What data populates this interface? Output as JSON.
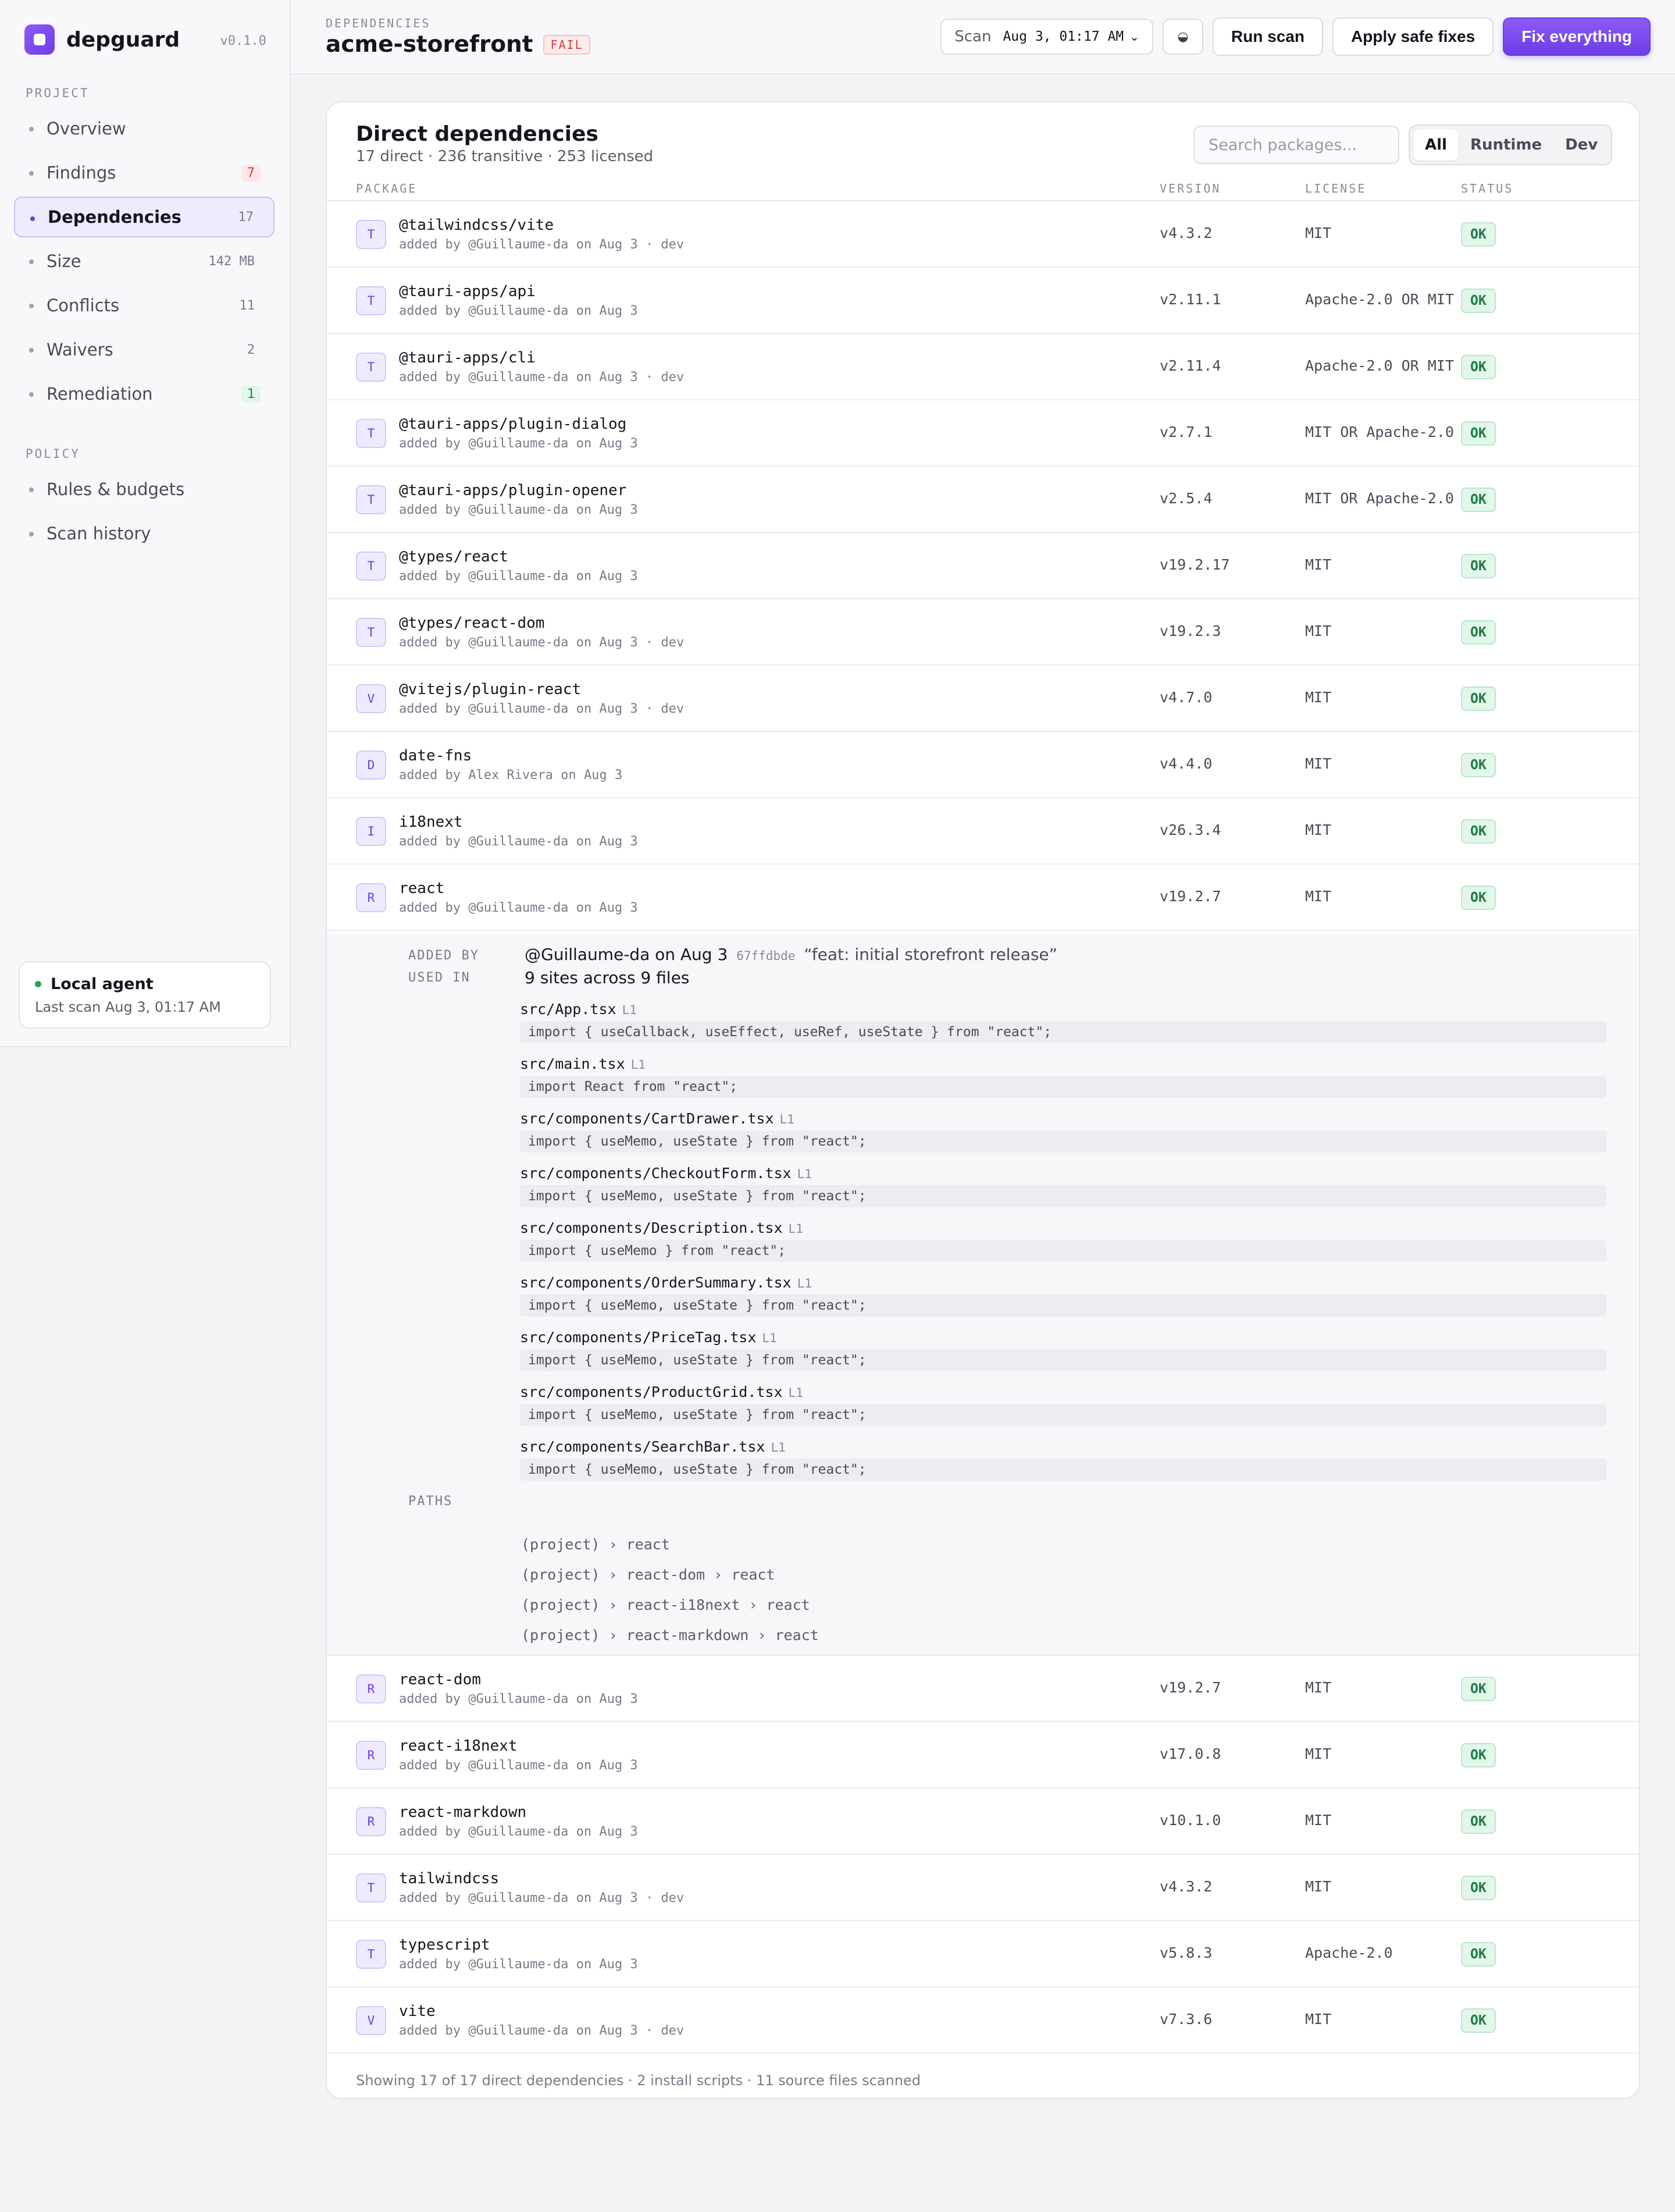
{
  "app": {
    "name": "depguard",
    "version": "v0.1.0"
  },
  "sidebar": {
    "project_label": "PROJECT",
    "policy_label": "POLICY",
    "project_items": [
      {
        "label": "Overview",
        "badge": ""
      },
      {
        "label": "Findings",
        "badge": "7"
      },
      {
        "label": "Dependencies",
        "badge": "17"
      },
      {
        "label": "Size",
        "badge": "142 MB"
      },
      {
        "label": "Conflicts",
        "badge": "11"
      },
      {
        "label": "Waivers",
        "badge": "2"
      },
      {
        "label": "Remediation",
        "badge": "1"
      }
    ],
    "policy_items": [
      {
        "label": "Rules & budgets"
      },
      {
        "label": "Scan history"
      }
    ],
    "agent": {
      "title": "Local agent",
      "subtitle": "Last scan Aug 3, 01:17 AM"
    }
  },
  "header": {
    "breadcrumb": "DEPENDENCIES",
    "project": "acme-storefront",
    "status": "FAIL",
    "scan_label": "Scan",
    "scan_value": "Aug 3, 01:17 AM",
    "theme_icon": "◒",
    "run_scan": "Run scan",
    "apply_safe": "Apply safe fixes",
    "fix_all": "Fix everything"
  },
  "card": {
    "title": "Direct dependencies",
    "subtitle": "17 direct · 236 transitive · 253 licensed",
    "search_placeholder": "Search packages...",
    "filters": [
      "All",
      "Runtime",
      "Dev"
    ],
    "columns": {
      "package": "PACKAGE",
      "version": "VERSION",
      "license": "LICENSE",
      "status": "STATUS"
    },
    "rows": [
      {
        "initial": "T",
        "name": "@tailwindcss/vite",
        "meta": "added by @Guillaume-da on Aug 3 · dev",
        "version": "v4.3.2",
        "license": "MIT",
        "status": "OK"
      },
      {
        "initial": "T",
        "name": "@tauri-apps/api",
        "meta": "added by @Guillaume-da on Aug 3",
        "version": "v2.11.1",
        "license": "Apache-2.0 OR MIT",
        "status": "OK"
      },
      {
        "initial": "T",
        "name": "@tauri-apps/cli",
        "meta": "added by @Guillaume-da on Aug 3 · dev",
        "version": "v2.11.4",
        "license": "Apache-2.0 OR MIT",
        "status": "OK"
      },
      {
        "initial": "T",
        "name": "@tauri-apps/plugin-dialog",
        "meta": "added by @Guillaume-da on Aug 3",
        "version": "v2.7.1",
        "license": "MIT OR Apache-2.0",
        "status": "OK"
      },
      {
        "initial": "T",
        "name": "@tauri-apps/plugin-opener",
        "meta": "added by @Guillaume-da on Aug 3",
        "version": "v2.5.4",
        "license": "MIT OR Apache-2.0",
        "status": "OK"
      },
      {
        "initial": "T",
        "name": "@types/react",
        "meta": "added by @Guillaume-da on Aug 3",
        "version": "v19.2.17",
        "license": "MIT",
        "status": "OK"
      },
      {
        "initial": "T",
        "name": "@types/react-dom",
        "meta": "added by @Guillaume-da on Aug 3 · dev",
        "version": "v19.2.3",
        "license": "MIT",
        "status": "OK"
      },
      {
        "initial": "V",
        "name": "@vitejs/plugin-react",
        "meta": "added by @Guillaume-da on Aug 3 · dev",
        "version": "v4.7.0",
        "license": "MIT",
        "status": "OK"
      },
      {
        "initial": "D",
        "name": "date-fns",
        "meta": "added by Alex Rivera on Aug 3",
        "version": "v4.4.0",
        "license": "MIT",
        "status": "OK"
      },
      {
        "initial": "I",
        "name": "i18next",
        "meta": "added by @Guillaume-da on Aug 3",
        "version": "v26.3.4",
        "license": "MIT",
        "status": "OK"
      },
      {
        "initial": "R",
        "name": "react",
        "meta": "added by @Guillaume-da on Aug 3",
        "version": "v19.2.7",
        "license": "MIT",
        "status": "OK"
      },
      {
        "initial": "R",
        "name": "react-dom",
        "meta": "added by @Guillaume-da on Aug 3",
        "version": "v19.2.7",
        "license": "MIT",
        "status": "OK"
      },
      {
        "initial": "R",
        "name": "react-i18next",
        "meta": "added by @Guillaume-da on Aug 3",
        "version": "v17.0.8",
        "license": "MIT",
        "status": "OK"
      },
      {
        "initial": "R",
        "name": "react-markdown",
        "meta": "added by @Guillaume-da on Aug 3",
        "version": "v10.1.0",
        "license": "MIT",
        "status": "OK"
      },
      {
        "initial": "T",
        "name": "tailwindcss",
        "meta": "added by @Guillaume-da on Aug 3 · dev",
        "version": "v4.3.2",
        "license": "MIT",
        "status": "OK"
      },
      {
        "initial": "T",
        "name": "typescript",
        "meta": "added by @Guillaume-da on Aug 3",
        "version": "v5.8.3",
        "license": "Apache-2.0",
        "status": "OK"
      },
      {
        "initial": "V",
        "name": "vite",
        "meta": "added by @Guillaume-da on Aug 3 · dev",
        "version": "v7.3.6",
        "license": "MIT",
        "status": "OK"
      }
    ],
    "detail": {
      "added_by_label": "ADDED BY",
      "used_in_label": "USED IN",
      "paths_label": "PATHS",
      "added_by": "@Guillaume-da on Aug 3",
      "commit": "67ffdbde",
      "commit_msg": "“feat: initial storefront release”",
      "used_in": "9 sites across 9 files",
      "sites": [
        {
          "file": "src/App.tsx",
          "line": "L1",
          "code": "import { useCallback, useEffect, useRef, useState } from \"react\";"
        },
        {
          "file": "src/main.tsx",
          "line": "L1",
          "code": "import React from \"react\";"
        },
        {
          "file": "src/components/CartDrawer.tsx",
          "line": "L1",
          "code": "import { useMemo, useState } from \"react\";"
        },
        {
          "file": "src/components/CheckoutForm.tsx",
          "line": "L1",
          "code": "import { useMemo, useState } from \"react\";"
        },
        {
          "file": "src/components/Description.tsx",
          "line": "L1",
          "code": "import { useMemo } from \"react\";"
        },
        {
          "file": "src/components/OrderSummary.tsx",
          "line": "L1",
          "code": "import { useMemo, useState } from \"react\";"
        },
        {
          "file": "src/components/PriceTag.tsx",
          "line": "L1",
          "code": "import { useMemo, useState } from \"react\";"
        },
        {
          "file": "src/components/ProductGrid.tsx",
          "line": "L1",
          "code": "import { useMemo, useState } from \"react\";"
        },
        {
          "file": "src/components/SearchBar.tsx",
          "line": "L1",
          "code": "import { useMemo, useState } from \"react\";"
        }
      ],
      "paths": [
        "(project) › react",
        "(project) › react-dom › react",
        "(project) › react-i18next › react",
        "(project) › react-markdown › react"
      ]
    },
    "footer": "Showing 17 of 17 direct dependencies · 2 install scripts · 11 source files scanned"
  },
  "colors": {
    "accent": "#6d3de6",
    "ok": "#1c7c45",
    "fail": "#d23b3b"
  }
}
